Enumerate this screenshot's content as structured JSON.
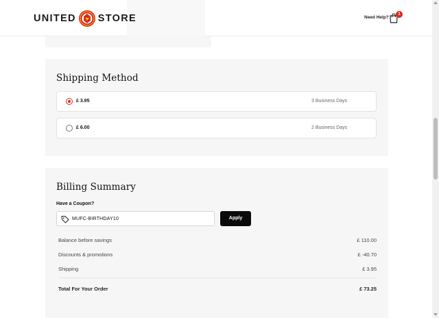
{
  "header": {
    "logo_left": "UNITED",
    "logo_right": "STORE",
    "need_help": "Need Help?",
    "cart_count": "1",
    "accent_color": "#da291c"
  },
  "shipping": {
    "title": "Shipping Method",
    "options": [
      {
        "price": "£ 3.95",
        "days": "3 Business Days",
        "selected": true
      },
      {
        "price": "£ 6.00",
        "days": "2 Business Days",
        "selected": false
      }
    ]
  },
  "billing": {
    "title": "Billing Summary",
    "coupon_label": "Have a Coupon?",
    "coupon_value": "MUFC-BIRTHDAY10",
    "apply_label": "Apply",
    "rows": [
      {
        "label": "Balance before savings",
        "value": "£ 110.00"
      },
      {
        "label": "Discounts & promotions",
        "value": "£ -40.70"
      },
      {
        "label": "Shipping",
        "value": "£ 3.95"
      }
    ],
    "total": {
      "label": "Total For Your Order",
      "value": "£ 73.25"
    }
  },
  "icons": {
    "crest": "club-crest-icon",
    "cart": "shopping-bag-icon",
    "coupon": "tag-icon"
  }
}
